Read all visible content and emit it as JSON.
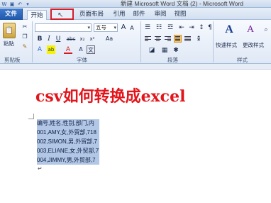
{
  "window": {
    "title": "新建 Microsoft Word 文档 (2) - Microsoft Word"
  },
  "qat": {
    "icons": [
      "save-icon",
      "undo-icon",
      "redo-icon"
    ]
  },
  "tabs": {
    "file": "文件",
    "home": "开始",
    "insert": "插入",
    "page_layout": "页面布局",
    "references": "引用",
    "mailings": "邮件",
    "review": "审阅",
    "view": "视图"
  },
  "ribbon": {
    "clipboard": {
      "paste_label": "粘贴",
      "group_label": "剪贴板"
    },
    "font": {
      "font_name": "",
      "font_size": "五号",
      "group_label": "字体",
      "bold": "B",
      "italic": "I",
      "underline": "U",
      "strike": "abc",
      "subscript": "x₂",
      "superscript": "x²",
      "grow": "A",
      "shrink": "A",
      "aa": "Aa",
      "font_color": "A",
      "highlight": "ab",
      "wen": "文"
    },
    "paragraph": {
      "group_label": "段落"
    },
    "styles": {
      "quick_styles": "快速样式",
      "change_styles": "更改样式",
      "group_label": "样式"
    }
  },
  "document": {
    "headline": "csv如何转换成excel",
    "csv_lines": [
      "编号,姓名,性别,部门,内",
      "001,AMY,女,外贸部,718",
      "002,SIMON,男,外贸部,7",
      "003,ELIANE,女,外贸部,7",
      "004,JIMMY,男,外贸部,7"
    ],
    "paragraph_mark": "↵"
  },
  "colors": {
    "headline": "#e3151c",
    "selection": "#b2c6e6",
    "file_tab": "#2a63b8",
    "highlight_box": "#d21f2a"
  }
}
